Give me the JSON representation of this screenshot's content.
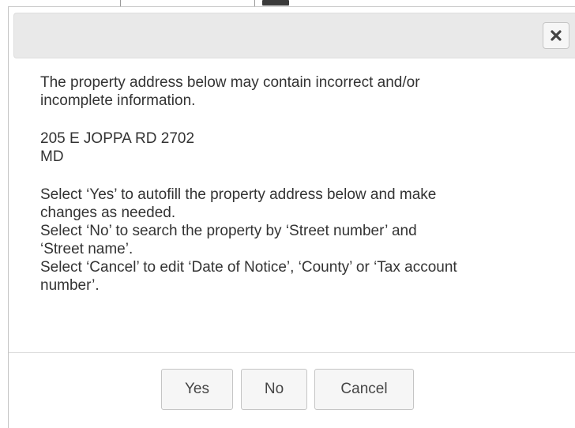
{
  "dialog": {
    "close_icon": "close-x-icon",
    "message_lines": [
      "The property address below may contain incorrect and/or",
      "incomplete information."
    ],
    "address_lines": [
      "205 E JOPPA RD 2702",
      "MD"
    ],
    "instruction_lines": [
      "Select ‘Yes’ to autofill the property address below and make",
      "changes as needed.",
      "Select ‘No’ to search the property by ‘Street number’ and",
      "‘Street name’.",
      "Select ‘Cancel’ to edit ‘Date of Notice’, ‘County’ or ‘Tax account",
      "number’."
    ],
    "buttons": {
      "yes": "Yes",
      "no": "No",
      "cancel": "Cancel"
    }
  },
  "colors": {
    "titlebar_bg": "#e9e9e9",
    "button_bg": "#f6f6f6",
    "border": "#c5c5c5",
    "text": "#333333"
  }
}
